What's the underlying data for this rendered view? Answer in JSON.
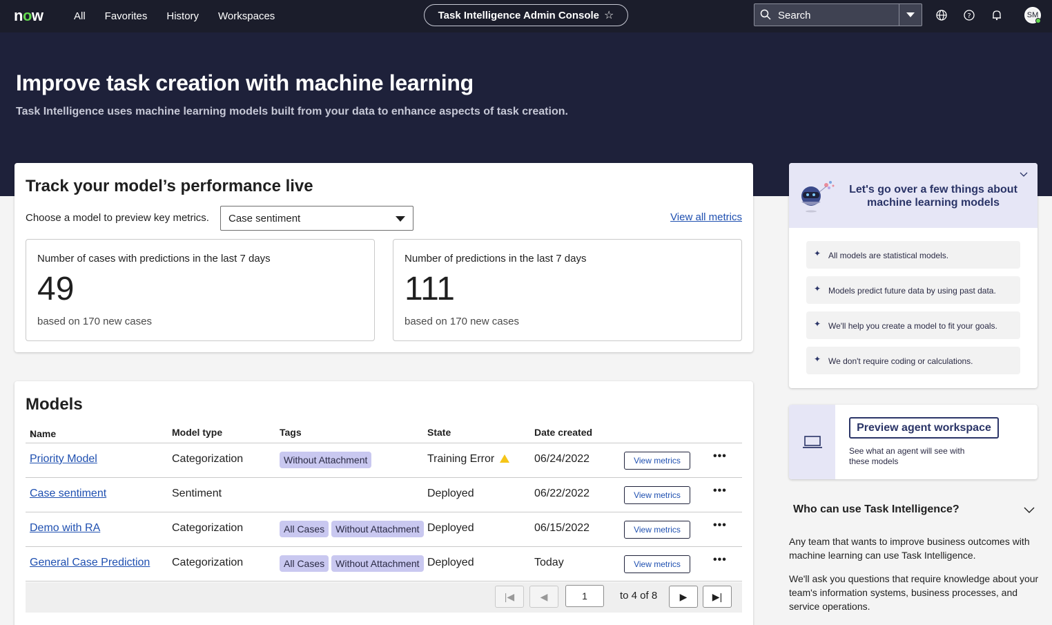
{
  "nav": {
    "logo": "now",
    "links": [
      "All",
      "Favorites",
      "History",
      "Workspaces"
    ],
    "title": "Task Intelligence Admin Console",
    "search_placeholder": "Search",
    "avatar": "SM"
  },
  "hero": {
    "title": "Improve task creation with machine learning",
    "subtitle": "Task Intelligence uses machine learning models built from your data to enhance aspects of task creation."
  },
  "track": {
    "title": "Track your model’s performance live",
    "choose_label": "Choose a model to preview key metrics.",
    "selected_model": "Case sentiment",
    "view_all": "View all metrics",
    "metrics": [
      {
        "label": "Number of cases with predictions in the last 7 days",
        "value": "49",
        "sub": "based on 170 new cases"
      },
      {
        "label": "Number of predictions in the last 7 days",
        "value": "111",
        "sub": "based on 170 new cases"
      }
    ]
  },
  "models": {
    "title": "Models",
    "headers": [
      "Name",
      "Model type",
      "Tags",
      "State",
      "Date created"
    ],
    "rows": [
      {
        "name": "Priority Model",
        "type": "Categorization",
        "tags": [
          "Without Attachment"
        ],
        "state": "Training Error",
        "date": "06/24/2022",
        "action": "View metrics"
      },
      {
        "name": "Case sentiment",
        "type": "Sentiment",
        "tags": [],
        "state": "Deployed",
        "date": "06/22/2022",
        "action": "View metrics"
      },
      {
        "name": "Demo with RA",
        "type": "Categorization",
        "tags": [
          "All Cases",
          "Without Attachment"
        ],
        "state": "Deployed",
        "date": "06/15/2022",
        "action": "View metrics"
      },
      {
        "name": "General Case Prediction",
        "type": "Categorization",
        "tags": [
          "All Cases",
          "Without Attachment"
        ],
        "state": "Deployed",
        "date": "Today",
        "action": "View metrics"
      }
    ],
    "pager": {
      "page": "1",
      "range": "to 4 of 8"
    }
  },
  "learn": {
    "title": "Let's go over a few things about machine learning models",
    "tips": [
      "All models are statistical models.",
      "Models predict future data by using past data.",
      "We'll help you create a model to fit your goals.",
      "We don't require coding or calculations."
    ]
  },
  "preview": {
    "button": "Preview agent workspace",
    "desc": "See what an agent will see with these models"
  },
  "who": {
    "title": "Who can use Task Intelligence?",
    "p1": "Any team that wants to improve business outcomes with machine learning can use Task Intelligence.",
    "p2": "We'll ask you questions that require knowledge about your team's information systems, business processes, and service operations."
  }
}
